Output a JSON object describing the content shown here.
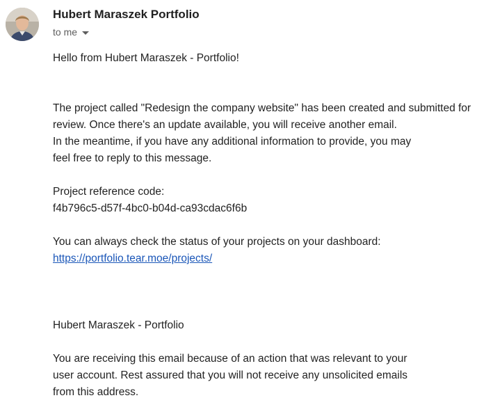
{
  "header": {
    "sender_name": "Hubert Maraszek Portfolio",
    "recipient_label": "to me",
    "avatar_icon": "person-avatar-icon",
    "details_icon": "caret-down-icon"
  },
  "message": {
    "greeting": "Hello from Hubert Maraszek - Portfolio!",
    "paragraph1": {
      "line1": "The project called \"Redesign the company website\" has been created and submitted for",
      "line2": "review. Once there's an update available, you will receive another email.",
      "line3": "In the meantime, if you have any additional information to provide, you may",
      "line4": "feel free to reply to this message."
    },
    "reference_label": "Project reference code:",
    "reference_code": "f4b796c5-d57f-4bc0-b04d-ca93cdac6f6b",
    "status_text": "You can always check the status of your projects on your dashboard:",
    "dashboard_link": "https://portfolio.tear.moe/projects/",
    "signature": "Hubert Maraszek - Portfolio",
    "footer": {
      "line1": "You are receiving this email because of an action that was relevant to your",
      "line2": "user account. Rest assured that you will not receive any unsolicited emails",
      "line3": "from this address."
    }
  },
  "colors": {
    "link": "#1a56b8",
    "text": "#222222",
    "muted": "#5e5e5e"
  }
}
